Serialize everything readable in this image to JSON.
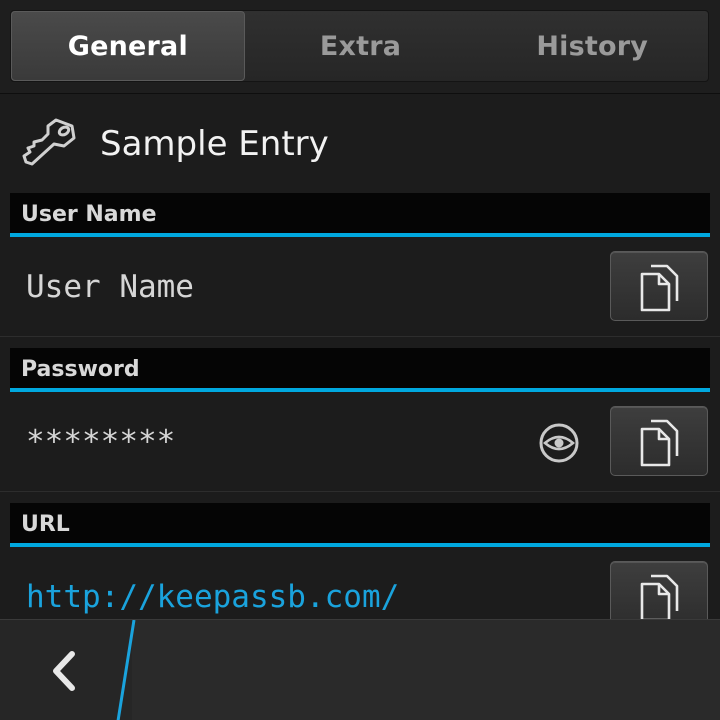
{
  "tabs": [
    {
      "label": "General",
      "active": true
    },
    {
      "label": "Extra",
      "active": false
    },
    {
      "label": "History",
      "active": false
    }
  ],
  "entry": {
    "title": "Sample Entry",
    "icon": "key-icon"
  },
  "fields": {
    "username": {
      "header": "User Name",
      "value": "User Name",
      "copy_icon": "copy-icon"
    },
    "password": {
      "header": "Password",
      "value": "********",
      "reveal_icon": "eye-icon",
      "copy_icon": "copy-icon"
    },
    "url": {
      "header": "URL",
      "value": "http://keepassb.com/",
      "copy_icon": "copy-icon"
    }
  },
  "bottom_bar": {
    "back_icon": "chevron-left-icon"
  },
  "colors": {
    "accent": "#00a8df",
    "link": "#1aa3dd",
    "background": "#1c1c1c"
  }
}
